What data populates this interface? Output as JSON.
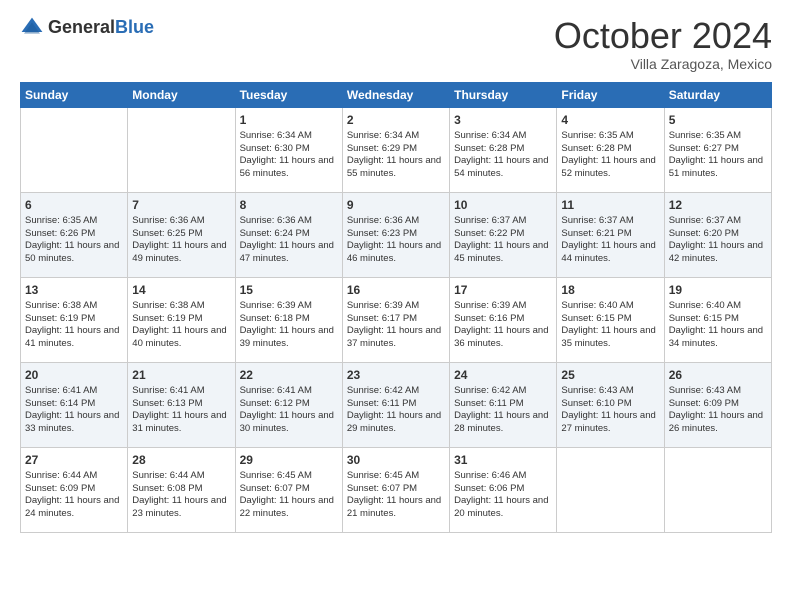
{
  "logo": {
    "line1": "General",
    "line2": "Blue"
  },
  "title": "October 2024",
  "subtitle": "Villa Zaragoza, Mexico",
  "weekdays": [
    "Sunday",
    "Monday",
    "Tuesday",
    "Wednesday",
    "Thursday",
    "Friday",
    "Saturday"
  ],
  "weeks": [
    [
      {
        "day": "",
        "info": ""
      },
      {
        "day": "",
        "info": ""
      },
      {
        "day": "1",
        "info": "Sunrise: 6:34 AM\nSunset: 6:30 PM\nDaylight: 11 hours and 56 minutes."
      },
      {
        "day": "2",
        "info": "Sunrise: 6:34 AM\nSunset: 6:29 PM\nDaylight: 11 hours and 55 minutes."
      },
      {
        "day": "3",
        "info": "Sunrise: 6:34 AM\nSunset: 6:28 PM\nDaylight: 11 hours and 54 minutes."
      },
      {
        "day": "4",
        "info": "Sunrise: 6:35 AM\nSunset: 6:28 PM\nDaylight: 11 hours and 52 minutes."
      },
      {
        "day": "5",
        "info": "Sunrise: 6:35 AM\nSunset: 6:27 PM\nDaylight: 11 hours and 51 minutes."
      }
    ],
    [
      {
        "day": "6",
        "info": "Sunrise: 6:35 AM\nSunset: 6:26 PM\nDaylight: 11 hours and 50 minutes."
      },
      {
        "day": "7",
        "info": "Sunrise: 6:36 AM\nSunset: 6:25 PM\nDaylight: 11 hours and 49 minutes."
      },
      {
        "day": "8",
        "info": "Sunrise: 6:36 AM\nSunset: 6:24 PM\nDaylight: 11 hours and 47 minutes."
      },
      {
        "day": "9",
        "info": "Sunrise: 6:36 AM\nSunset: 6:23 PM\nDaylight: 11 hours and 46 minutes."
      },
      {
        "day": "10",
        "info": "Sunrise: 6:37 AM\nSunset: 6:22 PM\nDaylight: 11 hours and 45 minutes."
      },
      {
        "day": "11",
        "info": "Sunrise: 6:37 AM\nSunset: 6:21 PM\nDaylight: 11 hours and 44 minutes."
      },
      {
        "day": "12",
        "info": "Sunrise: 6:37 AM\nSunset: 6:20 PM\nDaylight: 11 hours and 42 minutes."
      }
    ],
    [
      {
        "day": "13",
        "info": "Sunrise: 6:38 AM\nSunset: 6:19 PM\nDaylight: 11 hours and 41 minutes."
      },
      {
        "day": "14",
        "info": "Sunrise: 6:38 AM\nSunset: 6:19 PM\nDaylight: 11 hours and 40 minutes."
      },
      {
        "day": "15",
        "info": "Sunrise: 6:39 AM\nSunset: 6:18 PM\nDaylight: 11 hours and 39 minutes."
      },
      {
        "day": "16",
        "info": "Sunrise: 6:39 AM\nSunset: 6:17 PM\nDaylight: 11 hours and 37 minutes."
      },
      {
        "day": "17",
        "info": "Sunrise: 6:39 AM\nSunset: 6:16 PM\nDaylight: 11 hours and 36 minutes."
      },
      {
        "day": "18",
        "info": "Sunrise: 6:40 AM\nSunset: 6:15 PM\nDaylight: 11 hours and 35 minutes."
      },
      {
        "day": "19",
        "info": "Sunrise: 6:40 AM\nSunset: 6:15 PM\nDaylight: 11 hours and 34 minutes."
      }
    ],
    [
      {
        "day": "20",
        "info": "Sunrise: 6:41 AM\nSunset: 6:14 PM\nDaylight: 11 hours and 33 minutes."
      },
      {
        "day": "21",
        "info": "Sunrise: 6:41 AM\nSunset: 6:13 PM\nDaylight: 11 hours and 31 minutes."
      },
      {
        "day": "22",
        "info": "Sunrise: 6:41 AM\nSunset: 6:12 PM\nDaylight: 11 hours and 30 minutes."
      },
      {
        "day": "23",
        "info": "Sunrise: 6:42 AM\nSunset: 6:11 PM\nDaylight: 11 hours and 29 minutes."
      },
      {
        "day": "24",
        "info": "Sunrise: 6:42 AM\nSunset: 6:11 PM\nDaylight: 11 hours and 28 minutes."
      },
      {
        "day": "25",
        "info": "Sunrise: 6:43 AM\nSunset: 6:10 PM\nDaylight: 11 hours and 27 minutes."
      },
      {
        "day": "26",
        "info": "Sunrise: 6:43 AM\nSunset: 6:09 PM\nDaylight: 11 hours and 26 minutes."
      }
    ],
    [
      {
        "day": "27",
        "info": "Sunrise: 6:44 AM\nSunset: 6:09 PM\nDaylight: 11 hours and 24 minutes."
      },
      {
        "day": "28",
        "info": "Sunrise: 6:44 AM\nSunset: 6:08 PM\nDaylight: 11 hours and 23 minutes."
      },
      {
        "day": "29",
        "info": "Sunrise: 6:45 AM\nSunset: 6:07 PM\nDaylight: 11 hours and 22 minutes."
      },
      {
        "day": "30",
        "info": "Sunrise: 6:45 AM\nSunset: 6:07 PM\nDaylight: 11 hours and 21 minutes."
      },
      {
        "day": "31",
        "info": "Sunrise: 6:46 AM\nSunset: 6:06 PM\nDaylight: 11 hours and 20 minutes."
      },
      {
        "day": "",
        "info": ""
      },
      {
        "day": "",
        "info": ""
      }
    ]
  ]
}
